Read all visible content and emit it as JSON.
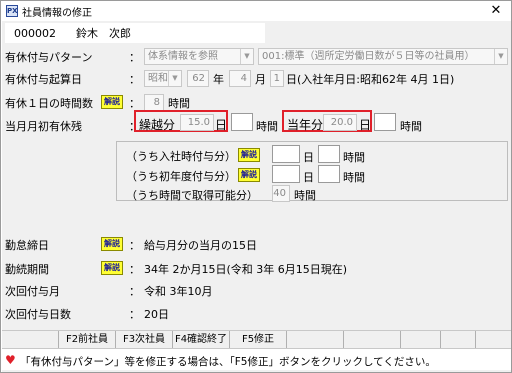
{
  "window": {
    "icon_text": "PX",
    "title": "社員情報の修正",
    "close_glyph": "✕"
  },
  "employee": {
    "id": "000002",
    "name": "鈴木　次郎"
  },
  "colon": "：",
  "rows": {
    "grant_pattern": {
      "label": "有休付与パターン",
      "system_select": "体系情報を参照",
      "pattern_select": "001:標準（週所定労働日数が５日等の社員用）"
    },
    "grant_start": {
      "label": "有休付与起算日",
      "era": "昭和",
      "year": "62",
      "year_unit": "年",
      "month": "4",
      "month_unit": "月",
      "day": "1",
      "day_unit": "日",
      "note": "(入社年月日:昭和62年 4月 1日)"
    },
    "daily_hours": {
      "label": "有休１日の時間数",
      "button": "解説",
      "value": "8",
      "unit": "時間"
    },
    "remaining": {
      "label": "当月月初有休残",
      "carry_label": "繰越分",
      "carry_value": "15.0",
      "carry_unit": "日",
      "carry_hour_unit": "時間",
      "current_label": "当年分",
      "current_value": "20.0",
      "current_unit": "日",
      "current_hour_unit": "時間"
    },
    "breakdown": {
      "joining_label": "（うち入社時付与分）",
      "joining_button": "解説",
      "joining_day_unit": "日",
      "joining_hour_unit": "時間",
      "first_year_label": "（うち初年度付与分）",
      "first_year_button": "解説",
      "first_year_day_unit": "日",
      "first_year_hour_unit": "時間",
      "hourly_label": "（うち時間で取得可能分）",
      "hourly_value": "40",
      "hourly_unit": "時間"
    },
    "attendance_cutoff": {
      "label": "勤怠締日",
      "button": "解説",
      "value": "給与月分の当月の15日"
    },
    "service_period": {
      "label": "勤続期間",
      "button": "解説",
      "value": "34年 2か月15日(令和 3年 6月15日現在)"
    },
    "next_grant_month": {
      "label": "次回付与月",
      "value": "令和 3年10月"
    },
    "next_grant_days": {
      "label": "次回付与日数",
      "value": "20日"
    }
  },
  "function_keys": [
    "",
    "F2前社員",
    "F3次社員",
    "F4確認終了",
    "F5修正",
    "",
    "",
    "",
    "",
    ""
  ],
  "status": {
    "icon": "♥",
    "message": "「有休付与パターン」等を修正する場合は、「F5修正」ボタンをクリックしてください。"
  },
  "colors": {
    "highlight_border": "#e0202a",
    "help_button_bg": "#ffff33",
    "help_button_text": "#1a1a9a"
  }
}
